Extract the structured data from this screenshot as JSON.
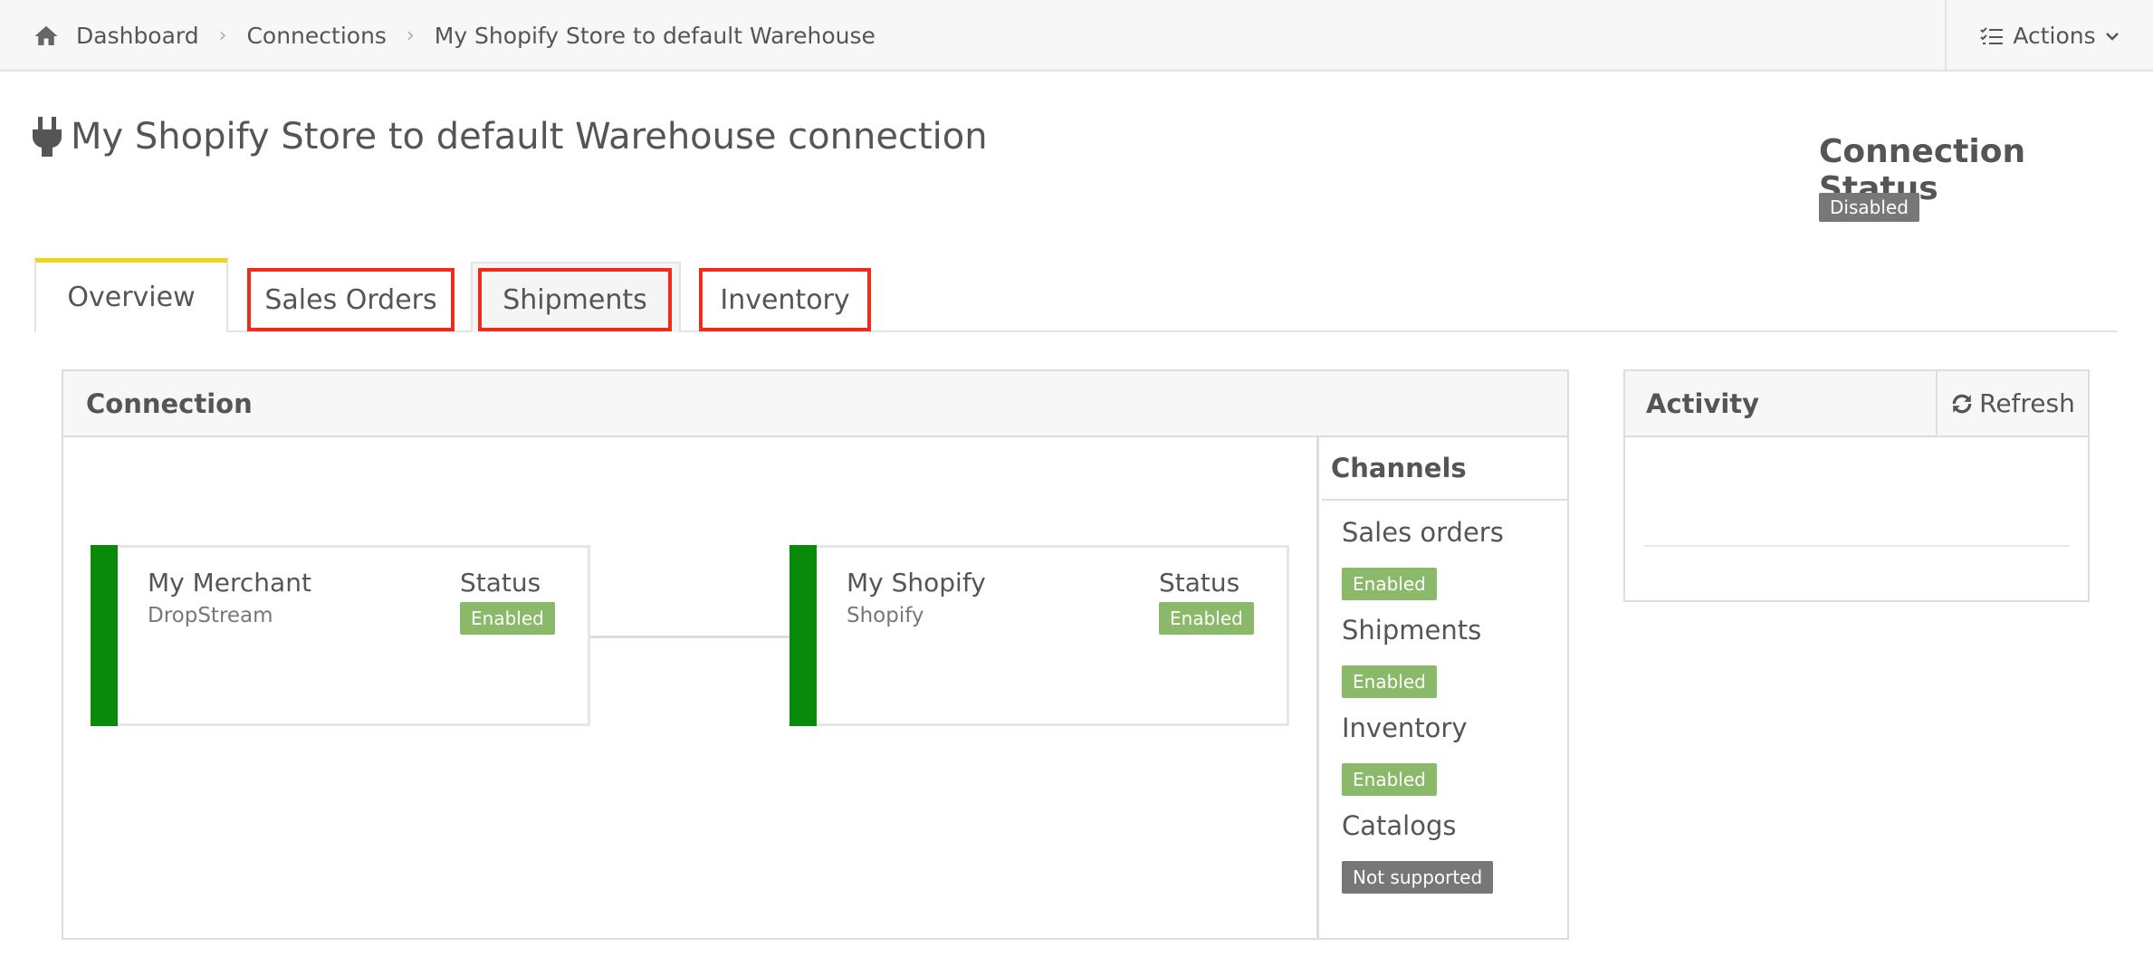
{
  "breadcrumb": {
    "items": [
      "Dashboard",
      "Connections",
      "My Shopify Store to default Warehouse"
    ],
    "home_icon": "home-icon"
  },
  "actions": {
    "label": "Actions",
    "icon": "list-check-icon"
  },
  "page": {
    "title": "My Shopify Store to default Warehouse connection",
    "title_icon": "plug-icon"
  },
  "connection_status": {
    "heading": "Connection Status",
    "badge": "Disabled"
  },
  "tabs": [
    {
      "label": "Overview",
      "active": true
    },
    {
      "label": "Sales Orders",
      "highlighted": true
    },
    {
      "label": "Shipments",
      "highlighted": true
    },
    {
      "label": "Inventory",
      "highlighted": true
    }
  ],
  "connection_panel": {
    "heading": "Connection",
    "nodes": [
      {
        "name": "My Merchant",
        "type": "DropStream",
        "status_label": "Status",
        "status": "Enabled"
      },
      {
        "name": "My Shopify",
        "type": "Shopify",
        "status_label": "Status",
        "status": "Enabled"
      }
    ],
    "channels": {
      "heading": "Channels",
      "items": [
        {
          "name": "Sales orders",
          "status": "Enabled"
        },
        {
          "name": "Shipments",
          "status": "Enabled"
        },
        {
          "name": "Inventory",
          "status": "Enabled"
        },
        {
          "name": "Catalogs",
          "status": "Not supported"
        }
      ]
    }
  },
  "activity": {
    "heading": "Activity",
    "refresh_label": "Refresh"
  },
  "colors": {
    "node_accent": "#0a8a0a",
    "enabled_badge": "#8ab96a",
    "neutral_badge": "#777777",
    "active_tab_accent": "#f5d317",
    "highlight_box": "#ef2b1b"
  }
}
